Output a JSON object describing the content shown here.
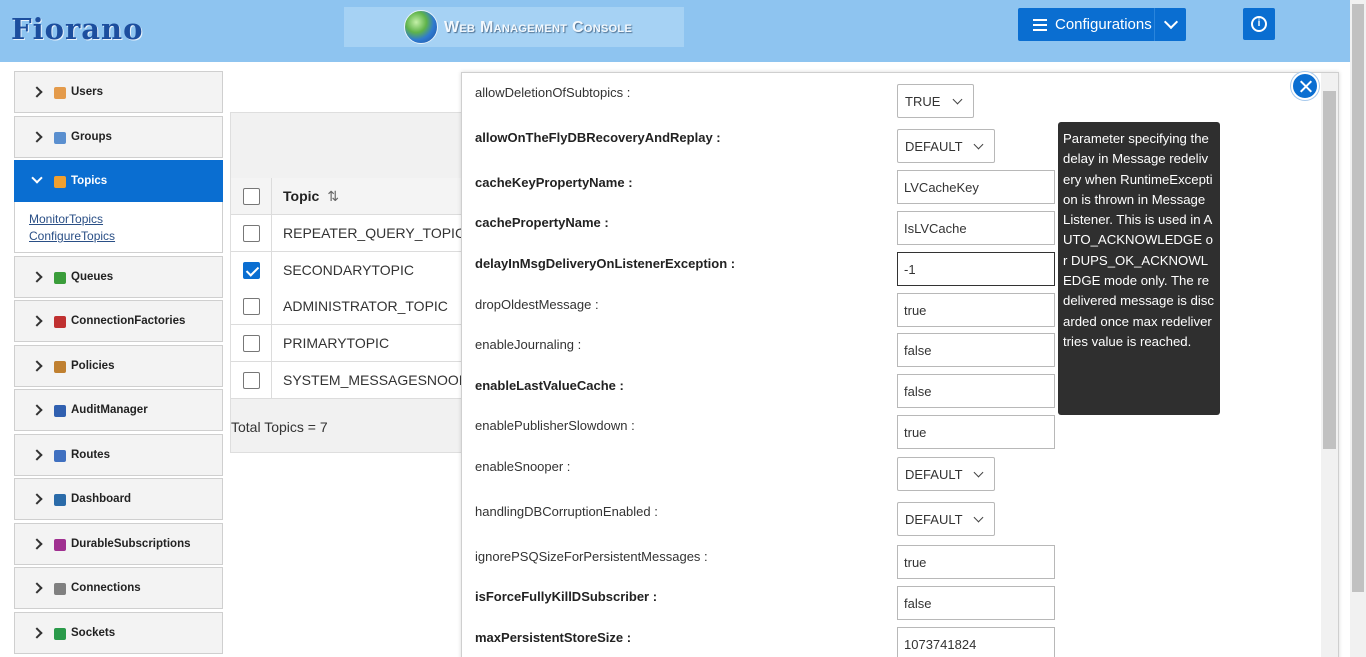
{
  "header": {
    "logo": "Fiorano",
    "console_title": "Web Management Console",
    "config_label": "Configurations",
    "info_symbol": "i"
  },
  "sidebar": {
    "items": [
      {
        "label": "Users",
        "icon": "user-icon",
        "color": "#e49b4b"
      },
      {
        "label": "Groups",
        "icon": "group-icon",
        "color": "#5a8fcf"
      },
      {
        "label": "Topics",
        "icon": "topic-icon",
        "color": "#f0a030",
        "active": true
      },
      {
        "label": "Queues",
        "icon": "queue-icon",
        "color": "#3a9d3a"
      },
      {
        "label": "ConnectionFactories",
        "icon": "connection-factory-icon",
        "color": "#c03030"
      },
      {
        "label": "Policies",
        "icon": "policy-icon",
        "color": "#c08030"
      },
      {
        "label": "AuditManager",
        "icon": "audit-icon",
        "color": "#3060b0"
      },
      {
        "label": "Routes",
        "icon": "route-icon",
        "color": "#4070c0"
      },
      {
        "label": "Dashboard",
        "icon": "dashboard-icon",
        "color": "#2a6aa8"
      },
      {
        "label": "DurableSubscriptions",
        "icon": "durable-subscription-icon",
        "color": "#a03090"
      },
      {
        "label": "Connections",
        "icon": "connection-icon",
        "color": "#808080"
      },
      {
        "label": "Sockets",
        "icon": "socket-icon",
        "color": "#2a9a4a"
      }
    ],
    "topics_sublinks": [
      "MonitorTopics",
      "ConfigureTopics"
    ]
  },
  "topics_table": {
    "column_header": "Topic",
    "rows": [
      {
        "name": "REPEATER_QUERY_TOPIC",
        "checked": false
      },
      {
        "name": "SECONDARYTOPIC",
        "checked": true
      },
      {
        "name": "ADMINISTRATOR_TOPIC",
        "checked": false
      },
      {
        "name": "PRIMARYTOPIC",
        "checked": false
      },
      {
        "name": "SYSTEM_MESSAGESNOOPER_",
        "checked": false
      }
    ],
    "total": "Total Topics = 7"
  },
  "dialog": {
    "properties": [
      {
        "label": "allowDeletionOfSubtopics :",
        "bold": false,
        "type": "select",
        "value": "TRUE"
      },
      {
        "label": "allowOnTheFlyDBRecoveryAndReplay :",
        "bold": true,
        "type": "select",
        "value": "DEFAULT"
      },
      {
        "label": "cacheKeyPropertyName :",
        "bold": true,
        "type": "input",
        "value": "LVCacheKey"
      },
      {
        "label": "cachePropertyName :",
        "bold": true,
        "type": "input",
        "value": "IsLVCache"
      },
      {
        "label": "delayInMsgDeliveryOnListenerException :",
        "bold": true,
        "type": "input",
        "value": "-1",
        "focused": true
      },
      {
        "label": "dropOldestMessage :",
        "bold": false,
        "type": "input",
        "value": "true"
      },
      {
        "label": "enableJournaling :",
        "bold": false,
        "type": "input",
        "value": "false"
      },
      {
        "label": "enableLastValueCache :",
        "bold": true,
        "type": "input",
        "value": "false"
      },
      {
        "label": "enablePublisherSlowdown :",
        "bold": false,
        "type": "input",
        "value": "true"
      },
      {
        "label": "enableSnooper :",
        "bold": false,
        "type": "select",
        "value": "DEFAULT"
      },
      {
        "label": "handlingDBCorruptionEnabled :",
        "bold": false,
        "type": "select",
        "value": "DEFAULT"
      },
      {
        "label": "ignorePSQSizeForPersistentMessages :",
        "bold": false,
        "type": "input",
        "value": "true"
      },
      {
        "label": "isForceFullyKillDSubscriber :",
        "bold": true,
        "type": "input",
        "value": "false"
      },
      {
        "label": "maxPersistentStoreSize :",
        "bold": true,
        "type": "input",
        "value": "1073741824"
      }
    ],
    "tooltip": "Parameter specifying the delay in Message redelivery when RuntimeException is thrown in Message Listener. This is used in AUTO_ACKNOWLEDGE or DUPS_OK_ACKNOWLEDGE mode only. The redelivered message is discarded once max redeliver tries value is reached."
  },
  "colors": {
    "header_bg": "#8ec4f0",
    "accent": "#0a6ed1",
    "tooltip_bg": "#2f2f2f"
  }
}
